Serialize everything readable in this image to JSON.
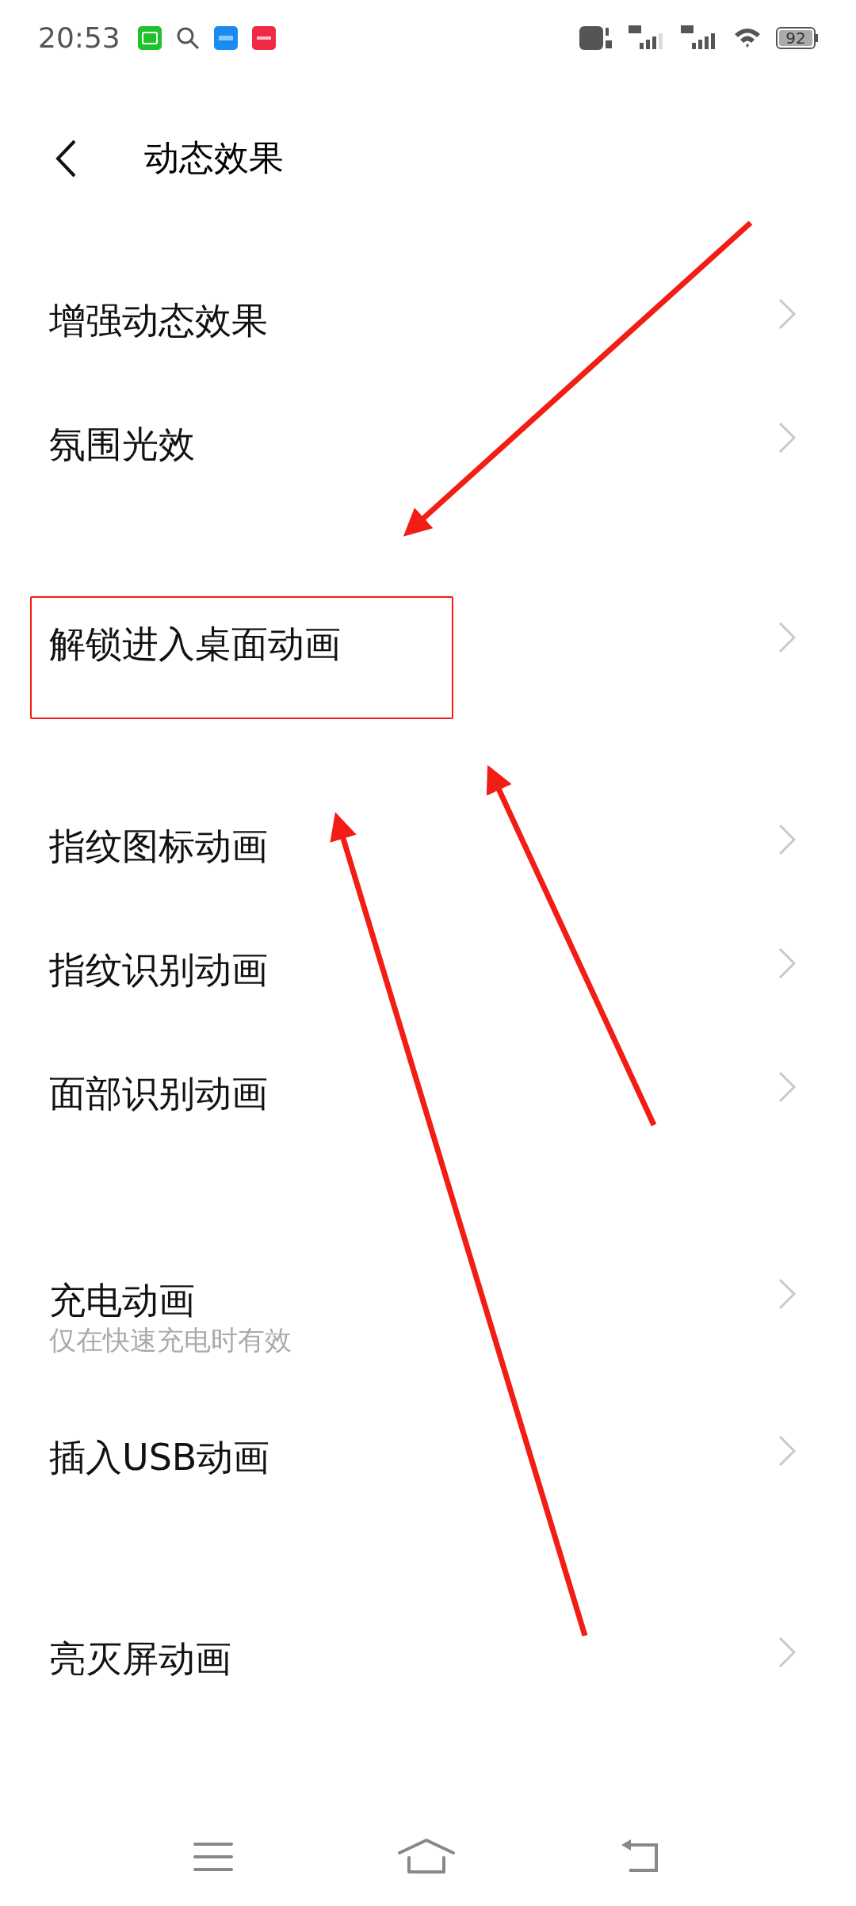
{
  "status_bar": {
    "time": "20:53",
    "battery": "92"
  },
  "header": {
    "title": "动态效果"
  },
  "groups": [
    {
      "items": [
        {
          "label": "增强动态效果",
          "highlighted": false
        },
        {
          "label": "氛围光效",
          "highlighted": false
        }
      ]
    },
    {
      "items": [
        {
          "label": "解锁进入桌面动画",
          "highlighted": true
        }
      ]
    },
    {
      "items": [
        {
          "label": "指纹图标动画",
          "highlighted": false
        },
        {
          "label": "指纹识别动画",
          "highlighted": false
        },
        {
          "label": "面部识别动画",
          "highlighted": false
        }
      ]
    },
    {
      "items": [
        {
          "label": "充电动画",
          "subtitle": "仅在快速充电时有效",
          "highlighted": false
        },
        {
          "label": "插入USB动画",
          "highlighted": false
        }
      ]
    },
    {
      "items": [
        {
          "label": "亮灭屏动画",
          "highlighted": false
        }
      ]
    }
  ]
}
